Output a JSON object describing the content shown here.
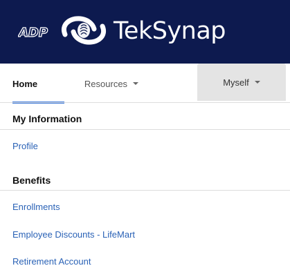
{
  "header": {
    "brand_name": "TekSynap",
    "partner_logo": "ADP",
    "brand_icon": "teksynap-fingerprint-icon",
    "background": "#0d1a4f"
  },
  "nav": {
    "tabs": [
      {
        "label": "Home",
        "active": true
      },
      {
        "label": "Resources",
        "has_dropdown": true
      },
      {
        "label": "Myself",
        "has_dropdown": true,
        "open": true
      }
    ],
    "accent": "#3c78d8"
  },
  "menu": {
    "sections": [
      {
        "title": "My Information",
        "items": [
          {
            "label": "Profile"
          }
        ]
      },
      {
        "title": "Benefits",
        "items": [
          {
            "label": "Enrollments"
          },
          {
            "label": "Employee Discounts - LifeMart"
          },
          {
            "label": "Retirement Account"
          }
        ]
      }
    ],
    "link_color": "#2a62b6"
  }
}
